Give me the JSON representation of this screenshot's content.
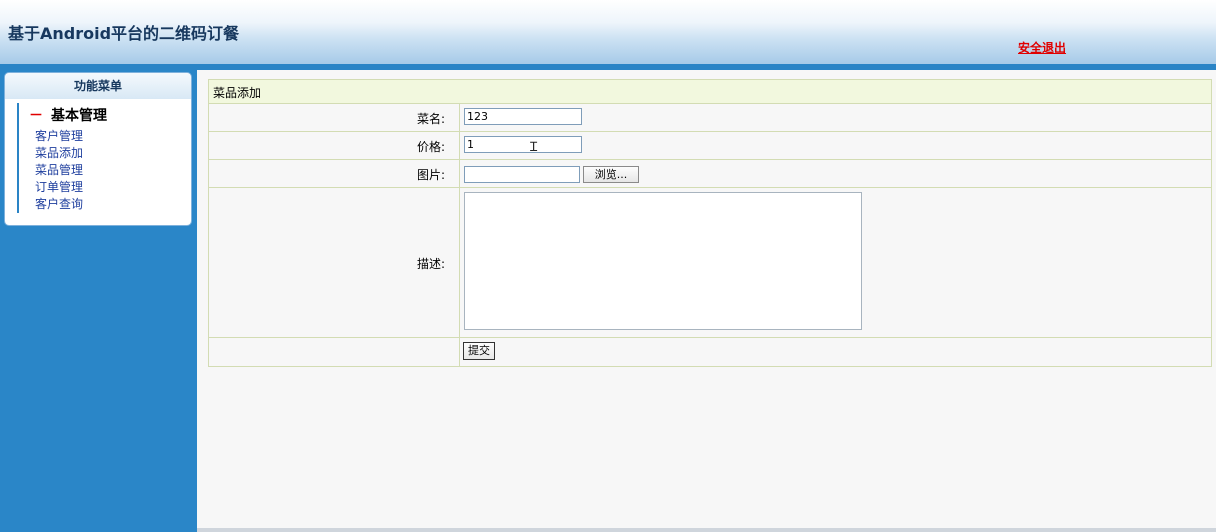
{
  "header": {
    "app_title": "基于Android平台的二维码订餐",
    "logout_label": "安全退出"
  },
  "sidebar": {
    "menu_title": "功能菜单",
    "group_dash": "－",
    "group_label": "基本管理",
    "items": [
      {
        "label": "客户管理"
      },
      {
        "label": "菜品添加"
      },
      {
        "label": "菜品管理"
      },
      {
        "label": "订单管理"
      },
      {
        "label": "客户查询"
      }
    ]
  },
  "form": {
    "title": "菜品添加",
    "fields": {
      "name": {
        "label": "菜名:",
        "value": "123"
      },
      "price": {
        "label": "价格:",
        "value": "1"
      },
      "image": {
        "label": "图片:",
        "browse_label": "浏览..."
      },
      "description": {
        "label": "描述:",
        "value": ""
      }
    },
    "submit_label": "提交"
  },
  "colors": {
    "header_band": "#2a84c6",
    "sidebar_bg": "#2a86c8",
    "logout": "#e00000",
    "title_row_bg": "#f2f8de",
    "table_border": "#d3dcb3"
  },
  "icons": {
    "text_cursor": "text-cursor-icon",
    "scroll_up": "scroll-up-arrow-icon",
    "scroll_down": "scroll-down-arrow-icon"
  }
}
